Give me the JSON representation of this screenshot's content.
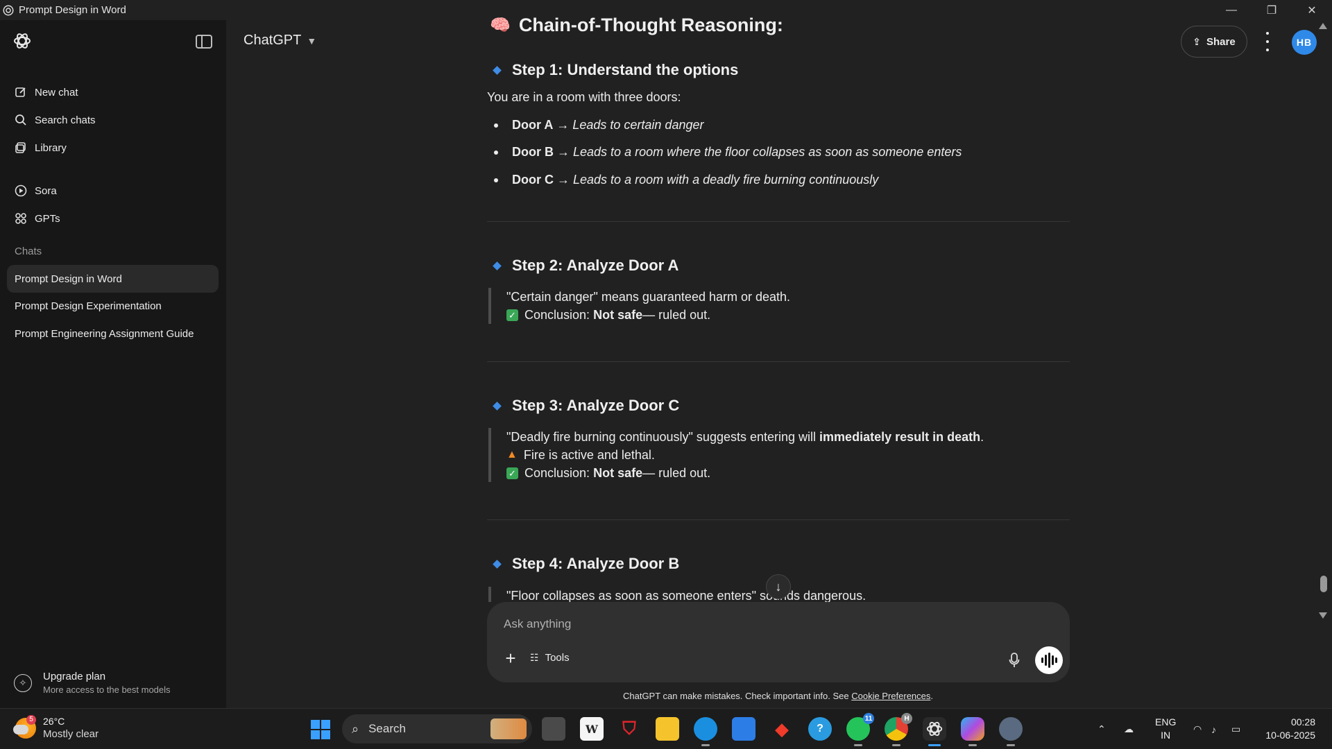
{
  "window": {
    "title": "Prompt Design in Word",
    "minimize": "—",
    "maximize": "❐",
    "close": "✕"
  },
  "sidebar": {
    "nav": [
      {
        "label": "New chat",
        "icon": "pencil-square-icon"
      },
      {
        "label": "Search chats",
        "icon": "search-icon"
      },
      {
        "label": "Library",
        "icon": "library-icon"
      },
      {
        "label": "Sora",
        "icon": "play-circle-icon"
      },
      {
        "label": "GPTs",
        "icon": "grid-icon"
      }
    ],
    "section_label": "Chats",
    "chats": [
      {
        "label": "Prompt Design in Word",
        "active": true
      },
      {
        "label": "Prompt Design Experimentation",
        "active": false
      },
      {
        "label": "Prompt Engineering Assignment Guide",
        "active": false
      }
    ],
    "upgrade": {
      "title": "Upgrade plan",
      "subtitle": "More access to the best models"
    }
  },
  "header": {
    "model": "ChatGPT",
    "share_label": "Share",
    "avatar_initials": "HB",
    "avatar_color": "#2f89e8"
  },
  "message": {
    "heading_emoji": "🧠",
    "heading": "Chain-of-Thought Reasoning:",
    "steps": [
      {
        "title": "Step 1: Understand the options"
      },
      {
        "title": "Step 2: Analyze Door A"
      },
      {
        "title": "Step 3: Analyze Door C"
      },
      {
        "title": "Step 4: Analyze Door B"
      }
    ],
    "intro": "You are in a room with three doors:",
    "doors": [
      {
        "name": "Door A",
        "arrow": " → ",
        "desc": "Leads to certain danger"
      },
      {
        "name": "Door B",
        "arrow": " → ",
        "desc": "Leads to a room where the floor collapses as soon as someone enters"
      },
      {
        "name": "Door C",
        "arrow": " → ",
        "desc": "Leads to a room with a deadly fire burning continuously"
      }
    ],
    "step2": {
      "line1": "\"Certain danger\" means guaranteed harm or death.",
      "concl_pre": "Conclusion: ",
      "concl_bold": "Not safe",
      "concl_post": " — ruled out."
    },
    "step3": {
      "line1_pre": "\"Deadly fire burning continuously\" suggests entering will ",
      "line1_bold": "immediately result in death",
      "line1_post": ".",
      "line2": "Fire is active and lethal.",
      "concl_pre": "Conclusion: ",
      "concl_bold": "Not safe",
      "concl_post": " — ruled out."
    },
    "step4": {
      "line1": "\"Floor collapses as soon as someone enters\" sounds dangerous."
    }
  },
  "composer": {
    "placeholder": "Ask anything",
    "tools_label": "Tools"
  },
  "disclaimer": {
    "text": "ChatGPT can make mistakes. Check important info. See ",
    "link": "Cookie Preferences",
    "end": "."
  },
  "taskbar": {
    "weather_temp": "26°C",
    "weather_desc": "Mostly clear",
    "weather_badge": "5",
    "search_label": "Search",
    "whatsapp_badge": "11",
    "chrome_badge": "H",
    "lang_top": "ENG",
    "lang_bottom": "IN",
    "time": "00:28",
    "date": "10-06-2025"
  }
}
